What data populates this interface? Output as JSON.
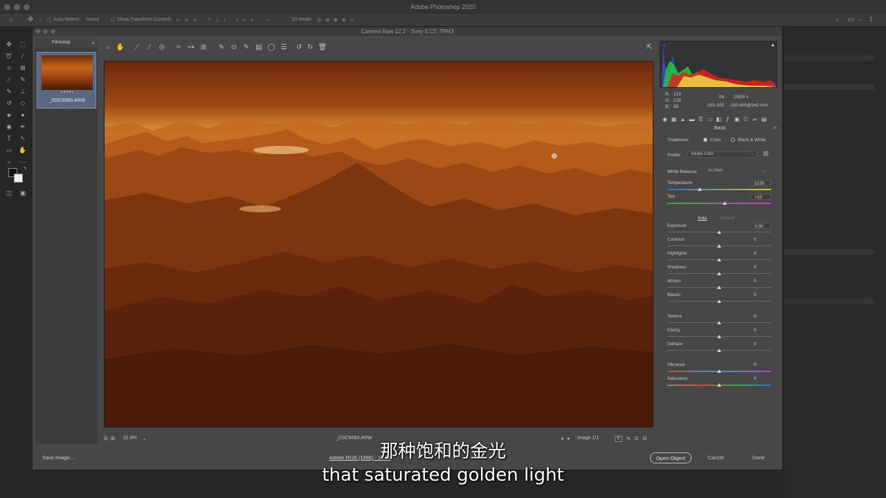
{
  "app": {
    "title": "Adobe Photoshop 2020"
  },
  "options_bar": {
    "auto_select_label": "Auto-Select:",
    "auto_select_mode": "Group",
    "transform_label": "Show Transform Controls",
    "mode_3d_label": "3D Mode:"
  },
  "camera_raw": {
    "title": "Camera Raw 12.2  -  Sony ILCE-7RM3",
    "filmstrip": {
      "label": "Filmstrip",
      "menu_icon": "menu-icon",
      "stars": "• • • • •",
      "filename": "_DSC6083.ARW"
    },
    "status": {
      "zoom": "31.9%",
      "filename": "_DSC6083.ARW",
      "image_counter": "Image 1/1"
    },
    "histogram_info": {
      "r_label": "R:",
      "g_label": "G:",
      "b_label": "B:",
      "r": "219",
      "g": "138",
      "b": "55",
      "aperture": "f/8",
      "shutter": "1/500 s",
      "iso": "ISO 200",
      "lens": "100-400@342 mm"
    },
    "panel": {
      "title": "Basic",
      "treatment_label": "Treatment:",
      "treatment_color": "Color",
      "treatment_bw": "Black & White",
      "profile_label": "Profile:",
      "profile_value": "Adobe Color",
      "wb_label": "White Balance:",
      "wb_value": "As Shot",
      "auto_label": "Auto",
      "default_label": "Default",
      "sliders": [
        {
          "label": "Temperature",
          "value": "5150",
          "position": 0.31
        },
        {
          "label": "Tint",
          "value": "+10",
          "position": 0.55
        },
        {
          "label": "Exposure",
          "value": "0.00",
          "position": 0.5
        },
        {
          "label": "Contrast",
          "value": "0",
          "position": 0.5
        },
        {
          "label": "Highlights",
          "value": "0",
          "position": 0.5
        },
        {
          "label": "Shadows",
          "value": "0",
          "position": 0.5
        },
        {
          "label": "Whites",
          "value": "0",
          "position": 0.5
        },
        {
          "label": "Blacks",
          "value": "0",
          "position": 0.5
        },
        {
          "label": "Texture",
          "value": "0",
          "position": 0.5
        },
        {
          "label": "Clarity",
          "value": "0",
          "position": 0.5
        },
        {
          "label": "Dehaze",
          "value": "0",
          "position": 0.5
        },
        {
          "label": "Vibrance",
          "value": "0",
          "position": 0.5
        },
        {
          "label": "Saturation",
          "value": "0",
          "position": 0.5
        }
      ]
    },
    "footer": {
      "save_image": "Save Image...",
      "workflow_link": "Adobe RGB (1998) - 16 bit",
      "open_object": "Open Object",
      "cancel": "Cancel",
      "done": "Done"
    }
  },
  "subtitle": {
    "zh": "那种饱和的金光",
    "en": "that saturated golden light"
  },
  "colors": {
    "accent": "#6f86b8",
    "sky_orange": "#e0902e",
    "mountain_dark": "#4a1a06"
  }
}
